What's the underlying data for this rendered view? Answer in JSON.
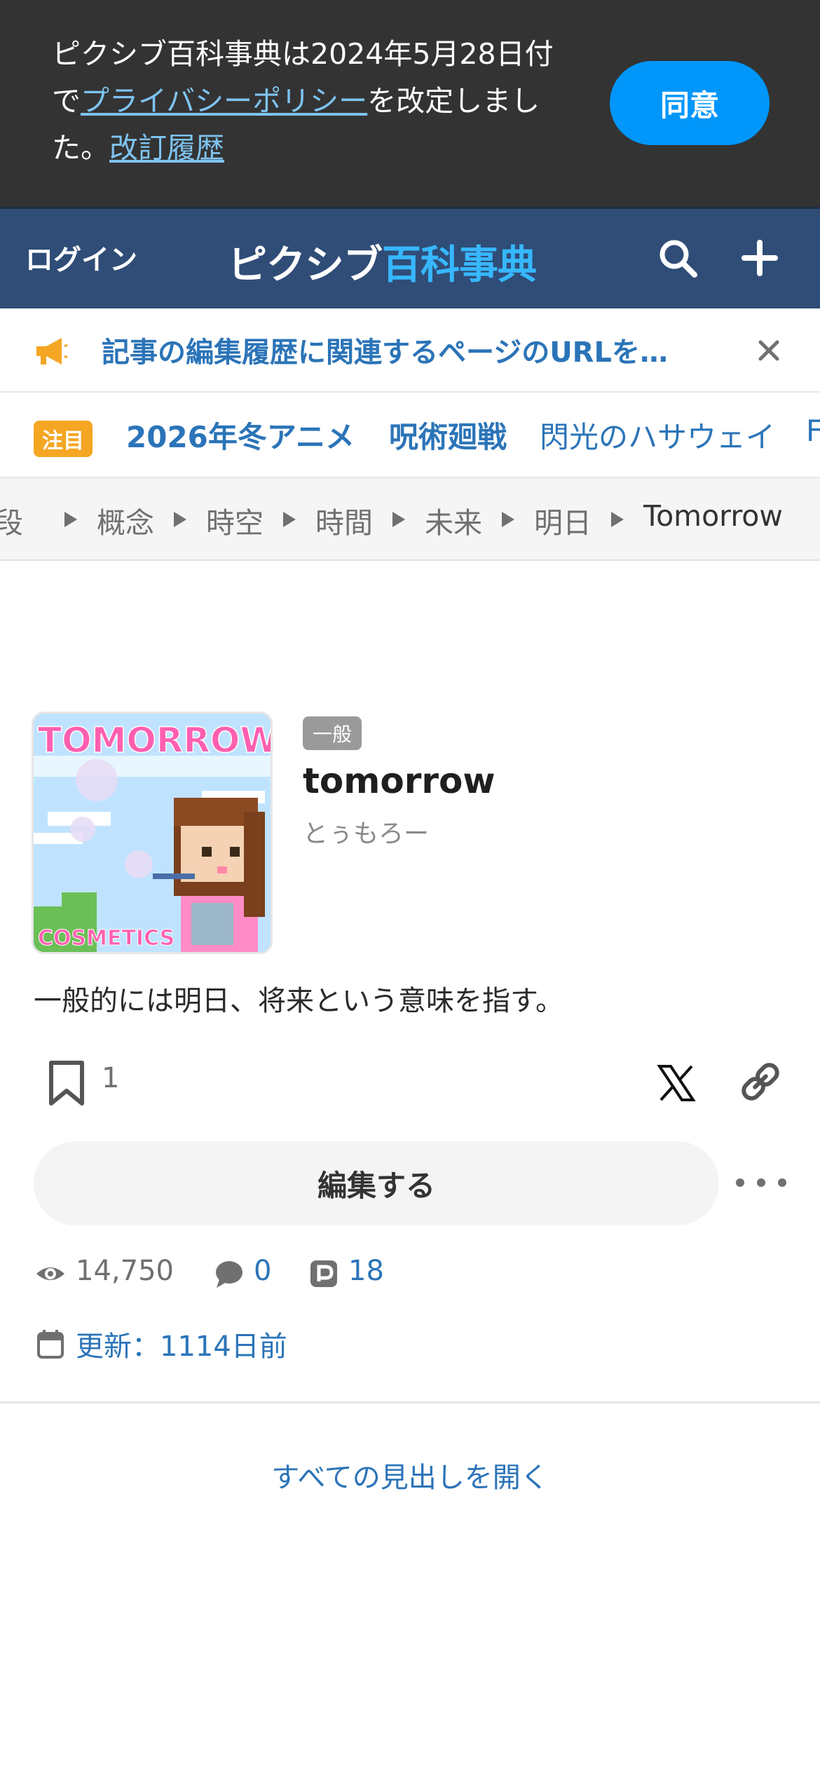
{
  "privacy_banner": {
    "text_before": "ピクシブ百科事典は2024年5月28日付で",
    "policy_link": "プライバシーポリシー",
    "text_middle": "を改定しました。",
    "history_link": "改訂履歴",
    "agree_label": "同意"
  },
  "header": {
    "login_label": "ログイン",
    "logo_part1": "ピクシブ",
    "logo_part2": "百科事典",
    "search_icon": "search-icon",
    "plus_icon": "plus-icon"
  },
  "notice": {
    "text": "記事の編集履歴に関連するページのURLを…",
    "icon": "megaphone-icon"
  },
  "trending": {
    "badge": "注目",
    "items": [
      "2026年冬アニメ",
      "呪術廻戦",
      "閃光のハサウェイ",
      "F"
    ]
  },
  "breadcrumb": [
    "概念",
    "時空",
    "時間",
    "未来",
    "明日",
    "Tomorrow"
  ],
  "article": {
    "category": "一般",
    "title": "tomorrow",
    "reading": "とぅもろー",
    "summary": "一般的には明日、将来という意味を指す。",
    "thumb_top_text": "TOMORROW",
    "thumb_bottom_text": "COSMETICS",
    "bookmark_count": "1",
    "edit_label": "編集する",
    "views": "14,750",
    "comments": "0",
    "pixiv_count": "18",
    "updated": "更新：1114日前",
    "open_all_label": "すべての見出しを開く"
  },
  "colors": {
    "accent": "#0096fa",
    "header_bg": "#2f4d77",
    "link": "#2b74b8",
    "badge": "#f5a623"
  }
}
